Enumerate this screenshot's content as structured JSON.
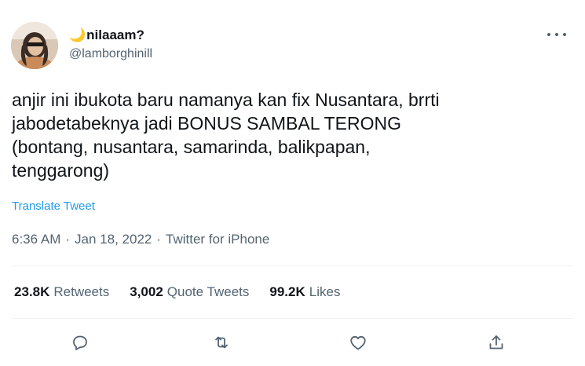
{
  "author": {
    "moon_emoji": "🌙",
    "display_name": "nilaaam?",
    "handle": "@lamborghinill"
  },
  "tweet": {
    "text": "anjir ini ibukota baru namanya kan fix Nusantara, brrti\njabodetabeknya jadi BONUS SAMBAL TERONG\n(bontang, nusantara, samarinda, balikpapan,\ntenggarong)",
    "translate_label": "Translate Tweet",
    "time": "6:36 AM",
    "date": "Jan 18, 2022",
    "source": "Twitter for iPhone",
    "separator": "·"
  },
  "stats": {
    "retweets_count": "23.8K",
    "retweets_label": "Retweets",
    "quotes_count": "3,002",
    "quotes_label": "Quote Tweets",
    "likes_count": "99.2K",
    "likes_label": "Likes"
  },
  "icons": {
    "more": "more-horizontal-icon",
    "reply": "reply-icon",
    "retweet": "retweet-icon",
    "like": "heart-icon",
    "share": "share-icon"
  },
  "colors": {
    "text": "#0f1419",
    "secondary": "#536471",
    "link": "#1d9bf0",
    "divider": "#eff3f4"
  }
}
